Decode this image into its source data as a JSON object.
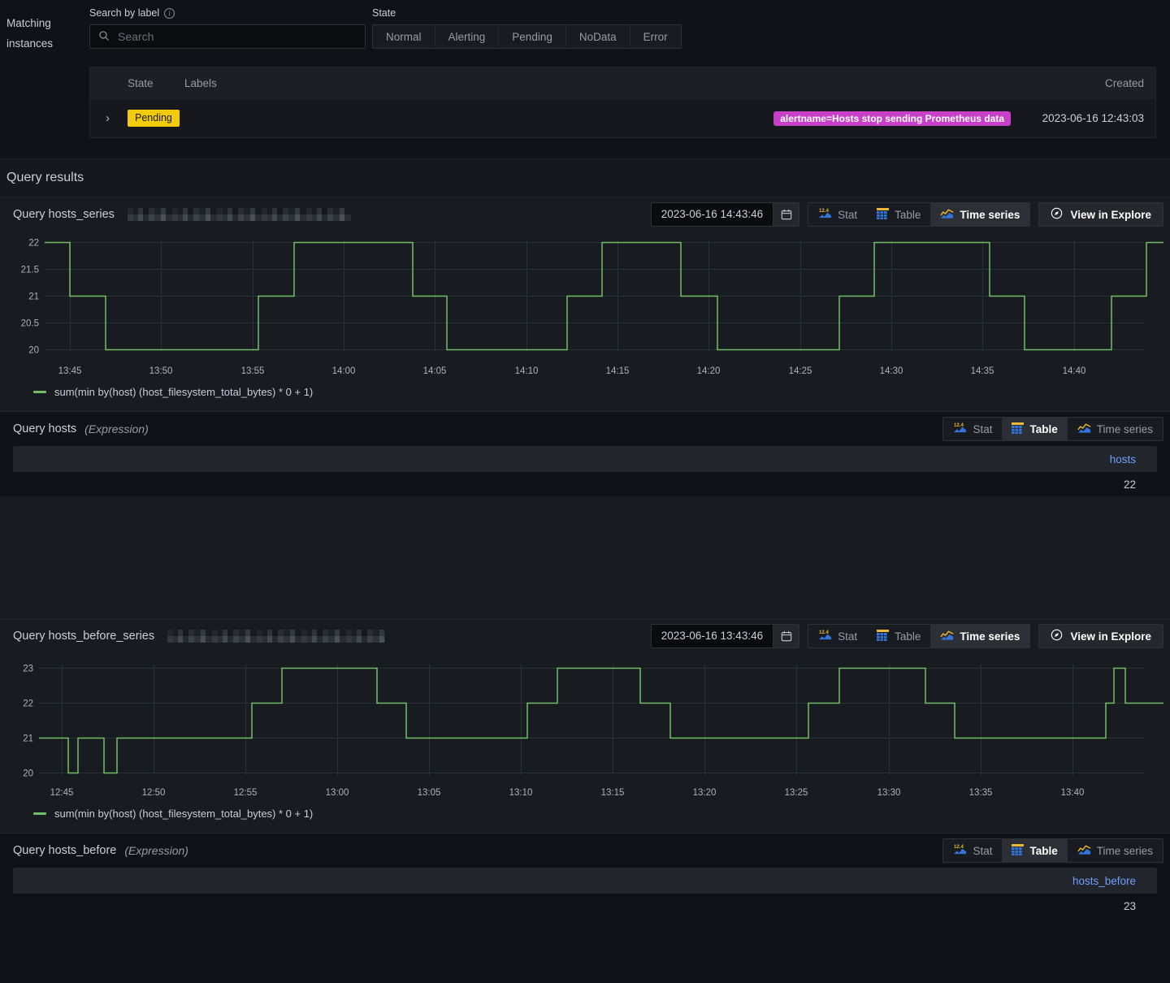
{
  "matching": {
    "section_label": "Matching instances",
    "search": {
      "label": "Search by label",
      "placeholder": "Search",
      "value": "",
      "info_glyph": "i"
    },
    "state_filter": {
      "label": "State",
      "options": [
        "Normal",
        "Alerting",
        "Pending",
        "NoData",
        "Error"
      ],
      "selected": ""
    },
    "table": {
      "columns": [
        "State",
        "Labels",
        "Created"
      ],
      "rows": [
        {
          "expand_glyph": "›",
          "state": "Pending",
          "state_color": "#f2cc0c",
          "label_chip": "alertname=Hosts stop sending Prometheus data",
          "label_color": "#c740c7",
          "created": "2023-06-16 12:43:03"
        }
      ]
    }
  },
  "query_results": {
    "heading": "Query results",
    "panels": [
      {
        "title": "Query hosts_series",
        "redacted_width": 275,
        "time_value": "2023-06-16 14:43:46",
        "viz": {
          "stat": "Stat",
          "table": "Table",
          "timeseries": "Time series",
          "active": "Time series"
        },
        "explore": "View in Explore",
        "legend": "sum(min by(host) (host_filesystem_total_bytes) * 0 + 1)"
      },
      {
        "title": "Query hosts",
        "subtitle": "(Expression)",
        "viz": {
          "stat": "Stat",
          "table": "Table",
          "timeseries": "Time series",
          "active": "Table"
        },
        "column": "hosts",
        "value": "22"
      },
      {
        "title": "Query hosts_before_series",
        "redacted_width": 268,
        "time_value": "2023-06-16 13:43:46",
        "viz": {
          "stat": "Stat",
          "table": "Table",
          "timeseries": "Time series",
          "active": "Time series"
        },
        "explore": "View in Explore",
        "legend": "sum(min by(host) (host_filesystem_total_bytes) * 0 + 1)"
      },
      {
        "title": "Query hosts_before",
        "subtitle": "(Expression)",
        "viz": {
          "stat": "Stat",
          "table": "Table",
          "timeseries": "Time series",
          "active": "Table"
        },
        "column": "hosts_before",
        "value": "23"
      }
    ]
  },
  "chart_data": [
    {
      "type": "line",
      "title": "Query hosts_series",
      "series_name": "sum(min by(host) (host_filesystem_total_bytes) * 0 + 1)",
      "line_color": "#73bf69",
      "interpolation": "step-after",
      "xlabel": "",
      "ylabel": "",
      "ylim": [
        19.75,
        22.25
      ],
      "yticks": [
        20,
        20.5,
        21,
        21.5,
        22
      ],
      "xticks": [
        "13:45",
        "13:50",
        "13:55",
        "14:00",
        "14:05",
        "14:10",
        "14:15",
        "14:20",
        "14:25",
        "14:30",
        "14:35",
        "14:40"
      ],
      "xlim": [
        "13:43",
        "14:43"
      ],
      "grid": true,
      "legend_position": "bottom-left",
      "x": [
        "13:43",
        "13:45",
        "13:46.5",
        "13:55.3",
        "13:56.5",
        "14:11.5",
        "14:13.5",
        "14:15",
        "14:16.5",
        "14:26.5",
        "14:28",
        "14:39.5",
        "14:41",
        "14:43"
      ],
      "values": [
        22,
        22,
        21,
        20,
        20,
        21,
        22,
        22,
        21,
        20,
        21,
        22,
        22,
        22
      ],
      "steps": [
        {
          "from": "13:43",
          "to": "13:45",
          "y": 22
        },
        {
          "from": "13:45",
          "to": "13:46.6",
          "y": 21
        },
        {
          "from": "13:46.6",
          "to": "13:55.3",
          "y": 20
        },
        {
          "from": "13:55.3",
          "to": "13:56.7",
          "y": 21
        },
        {
          "from": "13:56.7",
          "to": "14:03.3",
          "y": 22
        },
        {
          "from": "14:03.3",
          "to": "14:04.6",
          "y": 21
        },
        {
          "from": "14:04.6",
          "to": "14:11.6",
          "y": 20
        },
        {
          "from": "14:11.6",
          "to": "14:12.9",
          "y": 21
        },
        {
          "from": "14:12.9",
          "to": "14:17.2",
          "y": 22
        },
        {
          "from": "14:17.2",
          "to": "14:18.5",
          "y": 21
        },
        {
          "from": "14:18.5",
          "to": "14:26.5",
          "y": 20
        },
        {
          "from": "14:26.5",
          "to": "14:28",
          "y": 21
        },
        {
          "from": "14:28",
          "to": "14:33",
          "y": 22
        },
        {
          "from": "14:33",
          "to": "14:34.5",
          "y": 21
        },
        {
          "from": "14:34.5",
          "to": "14:40",
          "y": 20
        },
        {
          "from": "14:40",
          "to": "14:41.3",
          "y": 21
        },
        {
          "from": "14:41.3",
          "to": "14:43",
          "y": 22
        }
      ]
    },
    {
      "type": "table",
      "title": "Query hosts (Expression)",
      "columns": [
        "hosts"
      ],
      "rows": [
        [
          "22"
        ]
      ]
    },
    {
      "type": "line",
      "title": "Query hosts_before_series",
      "series_name": "sum(min by(host) (host_filesystem_total_bytes) * 0 + 1)",
      "line_color": "#73bf69",
      "interpolation": "step-after",
      "xlabel": "",
      "ylabel": "",
      "ylim": [
        19.6,
        23.4
      ],
      "yticks": [
        20,
        21,
        22,
        23
      ],
      "xticks": [
        "12:45",
        "12:50",
        "12:55",
        "13:00",
        "13:05",
        "13:10",
        "13:15",
        "13:20",
        "13:25",
        "13:30",
        "13:35",
        "13:40"
      ],
      "xlim": [
        "12:43",
        "13:43"
      ],
      "grid": true,
      "legend_position": "bottom-left",
      "steps": [
        {
          "from": "12:43",
          "to": "12:45.1",
          "y": 21
        },
        {
          "from": "12:45.1",
          "to": "12:45.6",
          "y": 20
        },
        {
          "from": "12:45.6",
          "to": "12:47.3",
          "y": 21
        },
        {
          "from": "12:47.3",
          "to": "12:49.2",
          "y": 20
        },
        {
          "from": "12:49.2",
          "to": "12:55.2",
          "y": 21
        },
        {
          "from": "12:55.2",
          "to": "12:56.7",
          "y": 22
        },
        {
          "from": "12:56.7",
          "to": "13:01.5",
          "y": 23
        },
        {
          "from": "13:01.5",
          "to": "13:03",
          "y": 22
        },
        {
          "from": "13:03",
          "to": "13:09.5",
          "y": 21
        },
        {
          "from": "13:09.5",
          "to": "13:11",
          "y": 22
        },
        {
          "from": "13:11",
          "to": "13:15.5",
          "y": 23
        },
        {
          "from": "13:15.5",
          "to": "13:17",
          "y": 22
        },
        {
          "from": "13:17",
          "to": "13:25.2",
          "y": 21
        },
        {
          "from": "13:25.2",
          "to": "13:26.6",
          "y": 22
        },
        {
          "from": "13:26.6",
          "to": "13:31.3",
          "y": 23
        },
        {
          "from": "13:31.3",
          "to": "13:32.6",
          "y": 22
        },
        {
          "from": "13:32.6",
          "to": "13:40.2",
          "y": 21
        },
        {
          "from": "13:40.2",
          "to": "13:41.3",
          "y": 22
        },
        {
          "from": "13:41.3",
          "to": "13:41.9",
          "y": 23
        },
        {
          "from": "13:41.9",
          "to": "13:43",
          "y": 22
        }
      ]
    },
    {
      "type": "table",
      "title": "Query hosts_before (Expression)",
      "columns": [
        "hosts_before"
      ],
      "rows": [
        [
          "23"
        ]
      ]
    }
  ]
}
